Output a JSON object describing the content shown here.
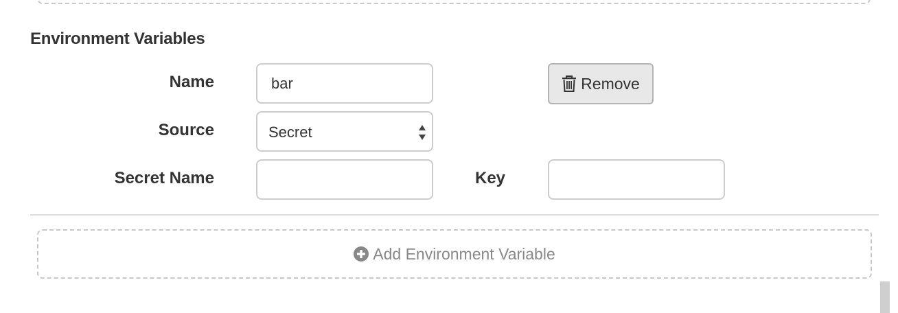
{
  "section": {
    "title": "Environment Variables"
  },
  "env_var": {
    "name_label": "Name",
    "name_value": "bar",
    "remove_button_label": "Remove",
    "source_label": "Source",
    "source_selected": "Secret",
    "secret_name_label": "Secret Name",
    "secret_name_value": "",
    "key_label": "Key",
    "key_value": ""
  },
  "add_button": {
    "label": "Add Environment Variable"
  },
  "icons": {
    "remove": "trash-icon",
    "add": "plus-circle-icon",
    "select": "select-arrows-icon"
  },
  "colors": {
    "text": "#333333",
    "muted_text": "#888888",
    "input_border": "#cccccc",
    "button_bg": "#e8e8e8",
    "dashed_border": "#c8c8c8"
  }
}
